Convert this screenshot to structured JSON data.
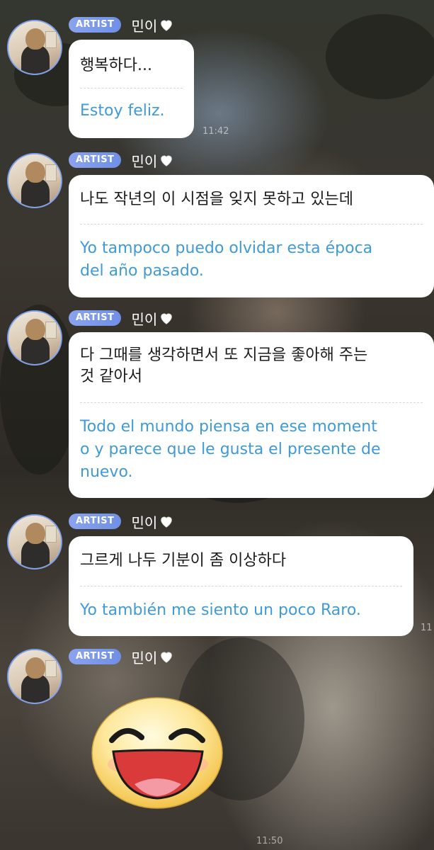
{
  "badge": "ARTIST",
  "username": "민이",
  "messages": [
    {
      "ko": "행복하다...",
      "es": "Estoy feliz.",
      "time": "11:42"
    },
    {
      "ko": "나도 작년의 이 시점을 잊지 못하고 있는데",
      "es_lines": [
        "Yo tampoco puedo olvidar esta época",
        "del año pasado."
      ]
    },
    {
      "ko_lines": [
        "다 그때를 생각하면서 또 지금을 좋아해 주는",
        "것 같아서"
      ],
      "es_lines": [
        "Todo el mundo piensa en ese moment",
        "o y parece que le gusta el presente de",
        "nuevo."
      ]
    },
    {
      "ko": "그르게 나두 기분이 좀 이상하다",
      "es": "Yo también me siento un poco Raro.",
      "time": "11"
    },
    {
      "emoji": "laughing-face-emoticon",
      "time": "11:50"
    }
  ],
  "colors": {
    "badge": "#7f9aea",
    "translation": "#3f9ad8",
    "avatar_ring": "#7ea0ea"
  }
}
